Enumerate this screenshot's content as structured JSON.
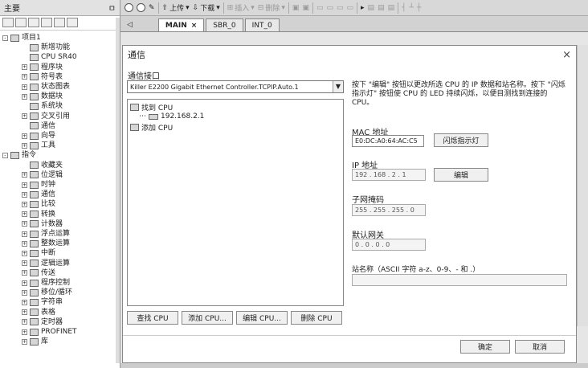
{
  "left_panel": {
    "title": "主要",
    "pin_icon": "ㅁ",
    "tree": [
      {
        "label": "项目1",
        "level": 0,
        "expand": "-"
      },
      {
        "label": "新增功能",
        "level": 1,
        "expand": ""
      },
      {
        "label": "CPU SR40",
        "level": 1,
        "expand": ""
      },
      {
        "label": "程序块",
        "level": 1,
        "expand": "+"
      },
      {
        "label": "符号表",
        "level": 1,
        "expand": "+"
      },
      {
        "label": "状态图表",
        "level": 1,
        "expand": "+"
      },
      {
        "label": "数据块",
        "level": 1,
        "expand": "+"
      },
      {
        "label": "系统块",
        "level": 1,
        "expand": ""
      },
      {
        "label": "交叉引用",
        "level": 1,
        "expand": "+"
      },
      {
        "label": "通信",
        "level": 1,
        "expand": ""
      },
      {
        "label": "向导",
        "level": 1,
        "expand": "+"
      },
      {
        "label": "工具",
        "level": 1,
        "expand": "+"
      },
      {
        "label": "指令",
        "level": 0,
        "expand": "-"
      },
      {
        "label": "收藏夹",
        "level": 1,
        "expand": ""
      },
      {
        "label": "位逻辑",
        "level": 1,
        "expand": "+"
      },
      {
        "label": "时钟",
        "level": 1,
        "expand": "+"
      },
      {
        "label": "通信",
        "level": 1,
        "expand": "+"
      },
      {
        "label": "比较",
        "level": 1,
        "expand": "+"
      },
      {
        "label": "转换",
        "level": 1,
        "expand": "+"
      },
      {
        "label": "计数器",
        "level": 1,
        "expand": "+"
      },
      {
        "label": "浮点运算",
        "level": 1,
        "expand": "+"
      },
      {
        "label": "整数运算",
        "level": 1,
        "expand": "+"
      },
      {
        "label": "中断",
        "level": 1,
        "expand": "+"
      },
      {
        "label": "逻辑运算",
        "level": 1,
        "expand": "+"
      },
      {
        "label": "传送",
        "level": 1,
        "expand": "+"
      },
      {
        "label": "程序控制",
        "level": 1,
        "expand": "+"
      },
      {
        "label": "移位/循环",
        "level": 1,
        "expand": "+"
      },
      {
        "label": "字符串",
        "level": 1,
        "expand": "+"
      },
      {
        "label": "表格",
        "level": 1,
        "expand": "+"
      },
      {
        "label": "定时器",
        "level": 1,
        "expand": "+"
      },
      {
        "label": "PROFINET",
        "level": 1,
        "expand": "+"
      },
      {
        "label": "库",
        "level": 1,
        "expand": "+"
      }
    ]
  },
  "toolbar": {
    "upload": "上传",
    "download": "下载",
    "insert": "插入",
    "delete": "删除"
  },
  "tabs": [
    {
      "label": "MAIN",
      "close": "×"
    },
    {
      "label": "SBR_0"
    },
    {
      "label": "INT_0"
    }
  ],
  "dialog": {
    "title": "通信",
    "close": "×",
    "interface_label": "通信接口",
    "interface_value": "Killer E2200 Gigabit Ethernet Controller.TCPIP.Auto.1",
    "list": {
      "found": "找到 CPU",
      "ip_item": "192.168.2.1",
      "added": "添加 CPU"
    },
    "description": "按下 \"编辑\" 按钮以更改所选 CPU 的 IP 数据和站名称。按下 \"闪烁指示灯\" 按钮使 CPU 的 LED 持续闪烁，以便目测找到连接的 CPU。",
    "mac_label": "MAC 地址",
    "mac_value": "E0:DC:A0:64:AC:C5",
    "flash_button": "闪烁指示灯",
    "ip_label": "IP 地址",
    "ip_value": "192 . 168 . 2 . 1",
    "edit_button": "编辑",
    "subnet_label": "子网掩码",
    "subnet_value": "255 . 255 . 255 . 0",
    "gateway_label": "默认网关",
    "gateway_value": "0 . 0 . 0 . 0",
    "station_label": "站名称（ASCII 字符 a-z、0-9、- 和 .）",
    "station_value": "",
    "buttons": {
      "find": "查找 CPU",
      "add": "添加 CPU...",
      "edit": "编辑 CPU...",
      "delete": "删除 CPU"
    },
    "ok": "确定",
    "cancel": "取消"
  }
}
